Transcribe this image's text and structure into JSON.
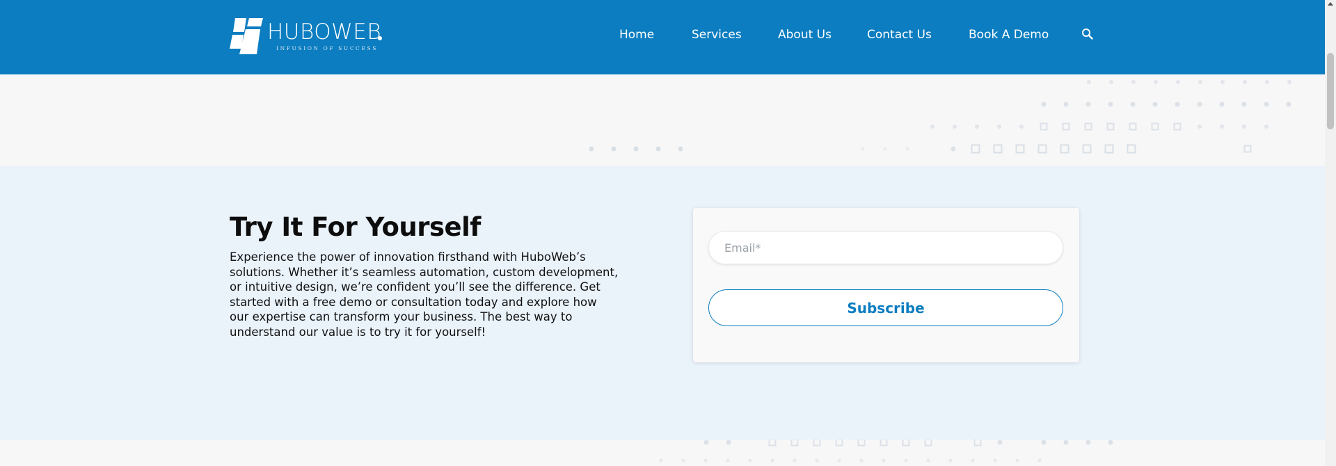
{
  "header": {
    "logo": {
      "wordmark": "HUBOWEB",
      "tagline": "INFUSION OF SUCCESS"
    },
    "nav": [
      {
        "label": "Home"
      },
      {
        "label": "Services"
      },
      {
        "label": "About Us"
      },
      {
        "label": "Contact Us"
      },
      {
        "label": "Book A Demo"
      }
    ],
    "search_icon": "search-icon"
  },
  "try_section": {
    "title": "Try It For Yourself",
    "body": "Experience the power of innovation firsthand with HuboWeb’s solutions. Whether it’s seamless automation, custom development, or intuitive design, we’re confident you’ll see the difference. Get started with a free demo or consultation today and explore how our expertise can transform your business. The best way to understand our value is to try it for yourself!",
    "form": {
      "email_placeholder": "Email*",
      "email_value": "",
      "subscribe_label": "Subscribe"
    }
  },
  "colors": {
    "brand_blue": "#0b7dc0",
    "section_bg": "#eaf2fa",
    "page_bg": "#f7f7f7"
  }
}
